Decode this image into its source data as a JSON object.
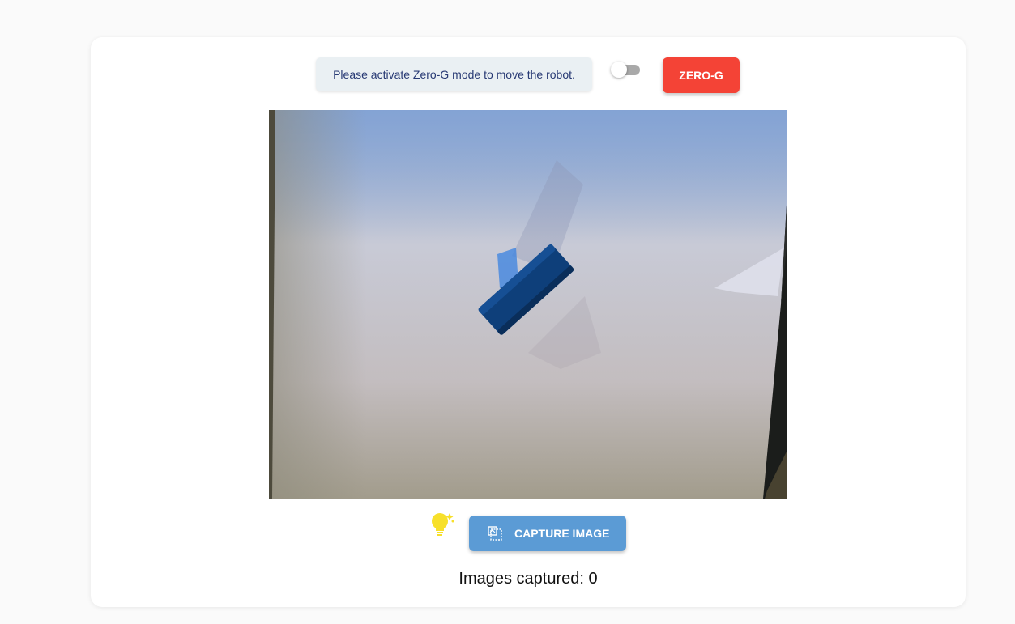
{
  "banner": {
    "text": "Please activate Zero-G mode to move the robot."
  },
  "zero_g_toggle": {
    "checked": false
  },
  "zero_g_button": {
    "label": "ZERO-G",
    "color": "#f44336"
  },
  "camera_feed": {
    "icon": "camera-feed"
  },
  "hint": {
    "icon": "lightbulb-icon",
    "color": "#f7e02a"
  },
  "capture_button": {
    "label": "CAPTURE IMAGE",
    "icon": "capture-icon",
    "color": "#5b9bd5"
  },
  "counter": {
    "label": "Images captured:",
    "value": 0,
    "text": "Images captured: 0"
  }
}
